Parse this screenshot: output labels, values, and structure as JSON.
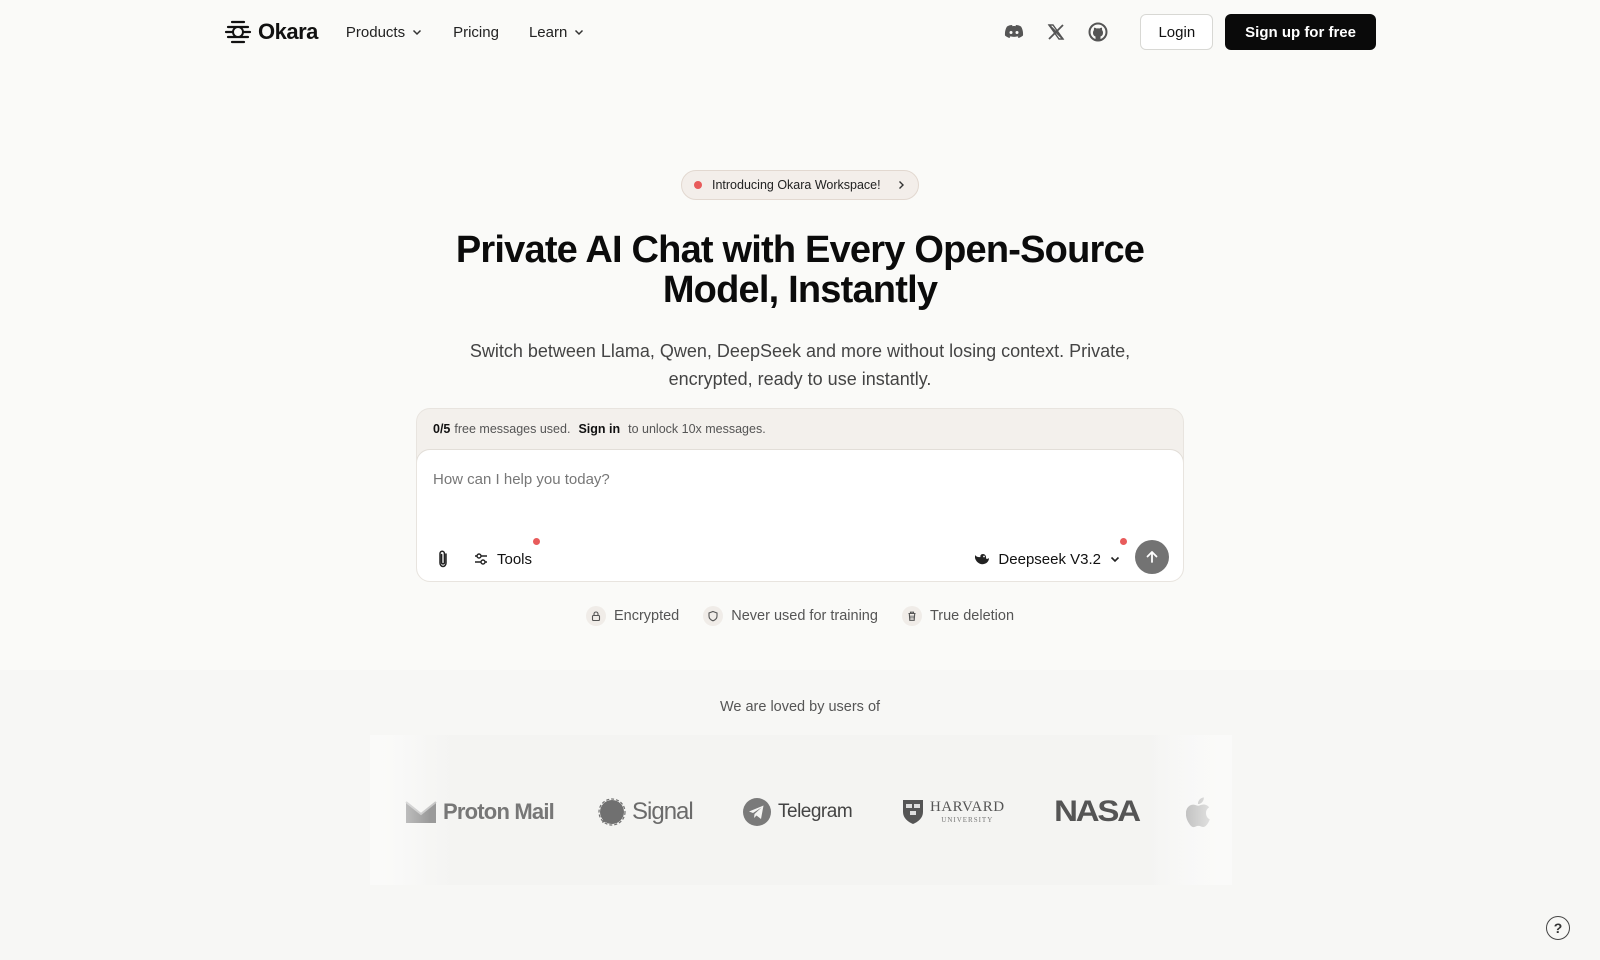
{
  "brand": {
    "name": "Okara"
  },
  "nav": {
    "products": "Products",
    "pricing": "Pricing",
    "learn": "Learn",
    "login": "Login",
    "signup": "Sign up for free"
  },
  "announcement": {
    "text": "Introducing Okara Workspace!"
  },
  "hero": {
    "title_line1": "Private AI Chat with Every Open-Source",
    "title_line2": "Model, Instantly",
    "subtitle_line1": "Switch between Llama, Qwen, DeepSeek and more without losing context. Private,",
    "subtitle_line2": "encrypted, ready to use instantly."
  },
  "chat": {
    "usage_count": "0/5",
    "usage_text": "free messages used.",
    "signin": "Sign in",
    "unlock_text": "to unlock 10x messages.",
    "placeholder": "How can I help you today?",
    "tools": "Tools",
    "model": "Deepseek V3.2"
  },
  "features": {
    "encrypted": "Encrypted",
    "training": "Never used for training",
    "deletion": "True deletion"
  },
  "loved": {
    "text": "We are loved by users of"
  },
  "logos": {
    "proton": "Proton Mail",
    "signal": "Signal",
    "telegram": "Telegram",
    "harvard": "HARVARD",
    "harvard_sub": "UNIVERSITY",
    "nasa": "NASA"
  },
  "colors": {
    "accent_dot": "#e85b5b",
    "primary_button": "#0a0a0a",
    "send_button": "#737373"
  }
}
